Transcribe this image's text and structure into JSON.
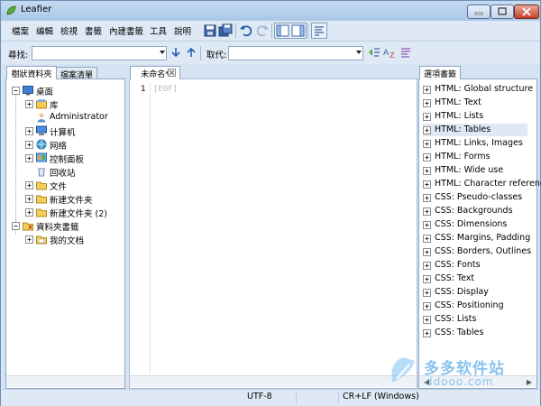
{
  "window": {
    "title": "Leafier"
  },
  "menu": [
    "檔案",
    "编輯",
    "檢視",
    "書籤",
    "內建書籤",
    "工具",
    "說明"
  ],
  "findbar": {
    "find_label": "尋找:",
    "replace_label": "取代:",
    "find_value": "",
    "replace_value": ""
  },
  "left_panel": {
    "tabs": [
      "樹狀資料夾",
      "檔案清單"
    ],
    "tree": [
      {
        "label": "桌面",
        "icon": "desktop-icon",
        "expander": "minus"
      },
      {
        "label": "库",
        "icon": "library-icon",
        "expander": "plus"
      },
      {
        "label": "Administrator",
        "icon": "user-icon",
        "expander": "none"
      },
      {
        "label": "计算机",
        "icon": "computer-icon",
        "expander": "plus"
      },
      {
        "label": "网络",
        "icon": "network-icon",
        "expander": "plus"
      },
      {
        "label": "控制面板",
        "icon": "control-panel-icon",
        "expander": "plus"
      },
      {
        "label": "回收站",
        "icon": "recycle-bin-icon",
        "expander": "none"
      },
      {
        "label": "文件",
        "icon": "folder-icon",
        "expander": "plus"
      },
      {
        "label": "新建文件夹",
        "icon": "folder-icon",
        "expander": "plus"
      },
      {
        "label": "新建文件夹 (2)",
        "icon": "folder-icon",
        "expander": "plus"
      },
      {
        "label": "資料夾書籤",
        "icon": "bookmark-folder-icon",
        "expander": "minus"
      },
      {
        "label": "我的文档",
        "icon": "documents-icon",
        "expander": "plus"
      }
    ]
  },
  "editor": {
    "tab_label": "未命名*",
    "line_number": "1",
    "content": "[EOF]"
  },
  "right_panel": {
    "tab_label": "選項書籤",
    "items": [
      "HTML: Global structure",
      "HTML: Text",
      "HTML: Lists",
      "HTML: Tables",
      "HTML: Links, Images",
      "HTML: Forms",
      "HTML: Wide use",
      "HTML: Character referenc",
      "CSS: Pseudo-classes",
      "CSS: Backgrounds",
      "CSS: Dimensions",
      "CSS: Margins, Padding",
      "CSS: Borders, Outlines",
      "CSS: Fonts",
      "CSS: Text",
      "CSS: Display",
      "CSS: Positioning",
      "CSS: Lists",
      "CSS: Tables"
    ],
    "selected_index": 3
  },
  "statusbar": {
    "encoding": "UTF-8",
    "line_ending": "CR+LF (Windows)"
  },
  "watermark": {
    "text_cn": "多多软件站",
    "url": "ddooo.com"
  },
  "colors": {
    "accent": "#316ac5",
    "frame": "#d5e3f2",
    "selection": "#dfe9f5"
  }
}
